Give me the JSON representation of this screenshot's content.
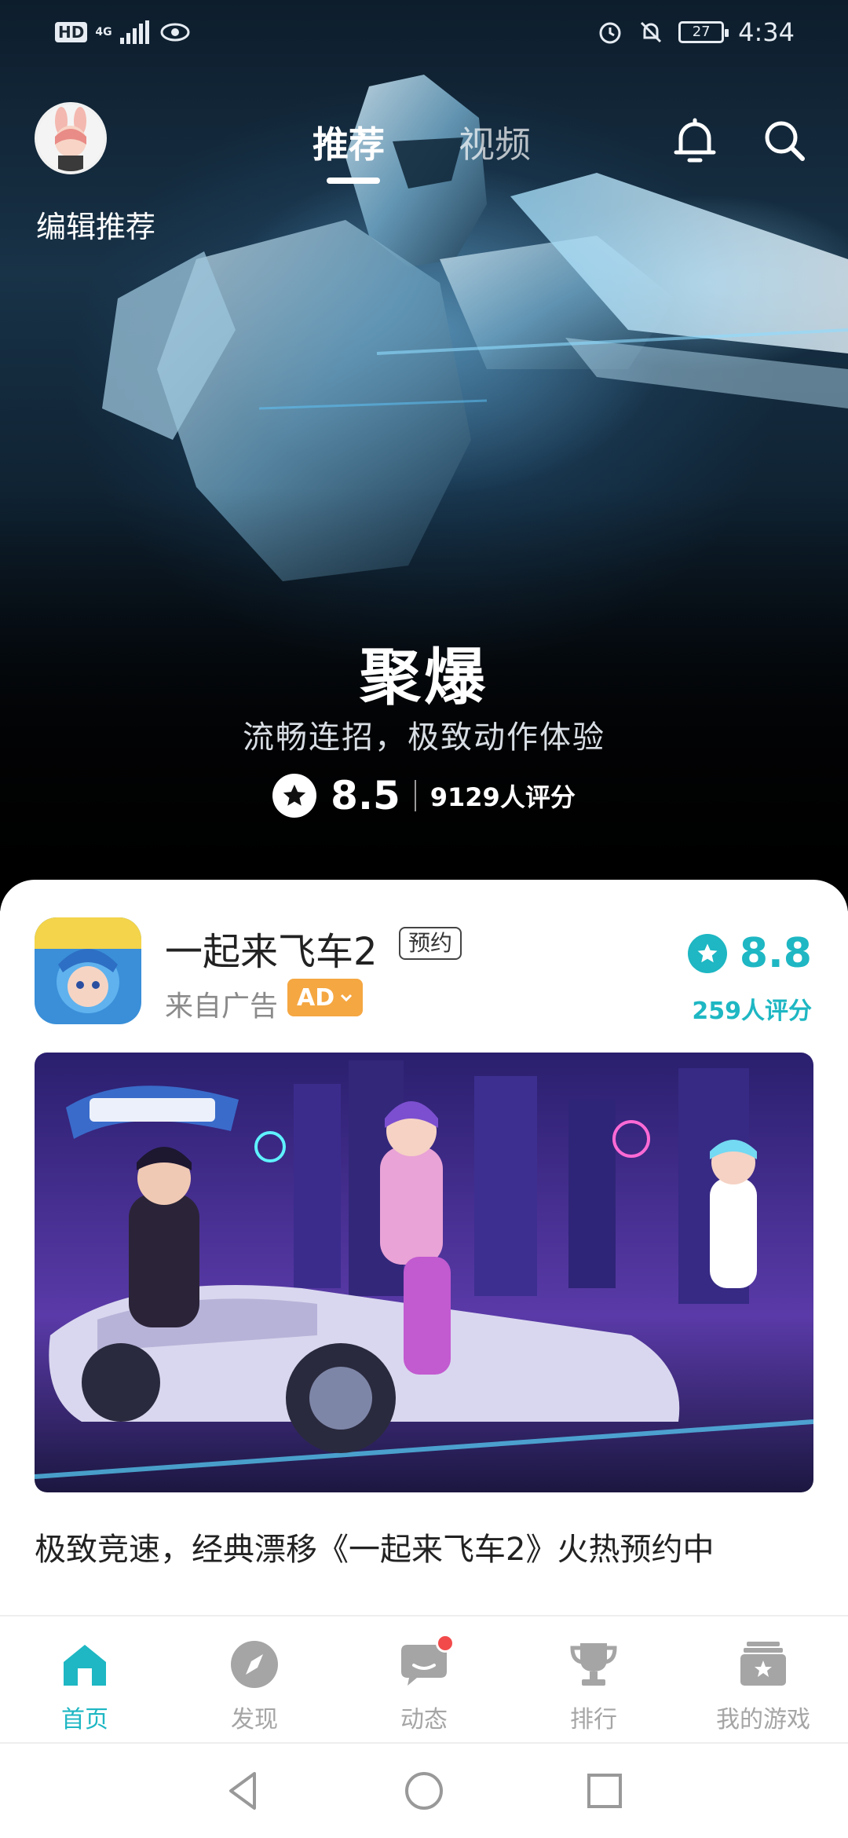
{
  "status_bar": {
    "hd": "HD",
    "network": "4G",
    "battery": "27",
    "time": "4:34",
    "icons": [
      "signal-icon",
      "eye-icon",
      "alarm-icon",
      "mute-icon",
      "battery-icon"
    ]
  },
  "header": {
    "tabs": [
      {
        "label": "推荐",
        "active": true
      },
      {
        "label": "视频",
        "active": false
      }
    ],
    "edit_label": "编辑推荐",
    "icons": [
      "bell-icon",
      "search-icon"
    ]
  },
  "hero": {
    "title": "聚爆",
    "subtitle": "流畅连招，极致动作体验",
    "score": "8.5",
    "rating_count": "9129人评分"
  },
  "card": {
    "app_name": "一起来飞车2",
    "tag": "预约",
    "source": "来自广告",
    "ad_badge": "AD",
    "score": "8.8",
    "rating_count": "259人评分",
    "description": "极致竞速，经典漂移《一起来飞车2》火热预约中"
  },
  "bottom_tabs": [
    {
      "label": "首页",
      "icon": "home-icon",
      "active": true
    },
    {
      "label": "发现",
      "icon": "compass-icon",
      "active": false
    },
    {
      "label": "动态",
      "icon": "message-icon",
      "active": false,
      "badge": true
    },
    {
      "label": "排行",
      "icon": "trophy-icon",
      "active": false
    },
    {
      "label": "我的游戏",
      "icon": "game-box-icon",
      "active": false
    }
  ],
  "system_nav": [
    "back-icon",
    "home-circle-icon",
    "recent-apps-icon"
  ],
  "colors": {
    "accent": "#1eb7c3",
    "ad_badge": "#f5a742",
    "badge_red": "#f24a4a",
    "inactive": "#a5a5a5"
  }
}
